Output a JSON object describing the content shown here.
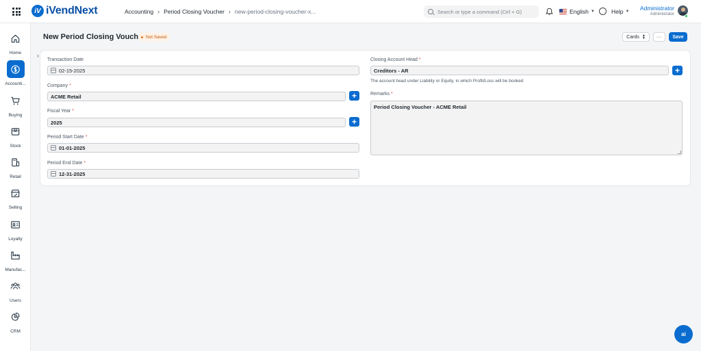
{
  "app": {
    "logo_text": "iVendNext",
    "logo_mark": "iV"
  },
  "breadcrumb": [
    "Accounting",
    "Period Closing Voucher",
    "new-period-closing-voucher-x..."
  ],
  "search": {
    "placeholder": "Search or type a command (Ctrl + G)"
  },
  "header_right": {
    "language": "English",
    "help": "Help",
    "user_name": "Administrator",
    "user_role": "Administrator"
  },
  "sidebar": {
    "items": [
      {
        "label": "Home",
        "icon": "home-icon"
      },
      {
        "label": "Accounti...",
        "icon": "dollar-icon",
        "active": true
      },
      {
        "label": "Buying",
        "icon": "cart-icon"
      },
      {
        "label": "Stock",
        "icon": "box-icon"
      },
      {
        "label": "Retail",
        "icon": "pos-icon"
      },
      {
        "label": "Selling",
        "icon": "store-icon"
      },
      {
        "label": "Loyalty",
        "icon": "id-card-icon"
      },
      {
        "label": "Manufac...",
        "icon": "factory-icon"
      },
      {
        "label": "Users",
        "icon": "users-icon"
      },
      {
        "label": "CRM",
        "icon": "pie-chart-icon"
      }
    ]
  },
  "page": {
    "title": "New Period Closing Voucher",
    "status": "Not Saved",
    "view_select": "Cards",
    "more_label": "···",
    "save_label": "Save"
  },
  "form": {
    "transaction_date": {
      "label": "Transaction Date",
      "value": "02-15-2025"
    },
    "company": {
      "label": "Company",
      "value": "ACME Retail"
    },
    "fiscal_year": {
      "label": "Fiscal Year",
      "value": "2025"
    },
    "period_start_date": {
      "label": "Period Start Date",
      "value": "01-01-2025"
    },
    "period_end_date": {
      "label": "Period End Date",
      "value": "12-31-2025"
    },
    "closing_account_head": {
      "label": "Closing Account Head",
      "value": "Creditors - AR",
      "help": "The account head under Liability or Equity, in which Profit/Loss will be booked"
    },
    "remarks": {
      "label": "Remarks",
      "value": "Period Closing Voucher - ACME Retail"
    },
    "required_mark": "*",
    "add_label": "+"
  },
  "assistant": {
    "label": "ai"
  },
  "colors": {
    "accent": "#0a6ccf",
    "status_bg": "#fff2e6",
    "status_text": "#c4580f",
    "required": "#e24c4c"
  }
}
